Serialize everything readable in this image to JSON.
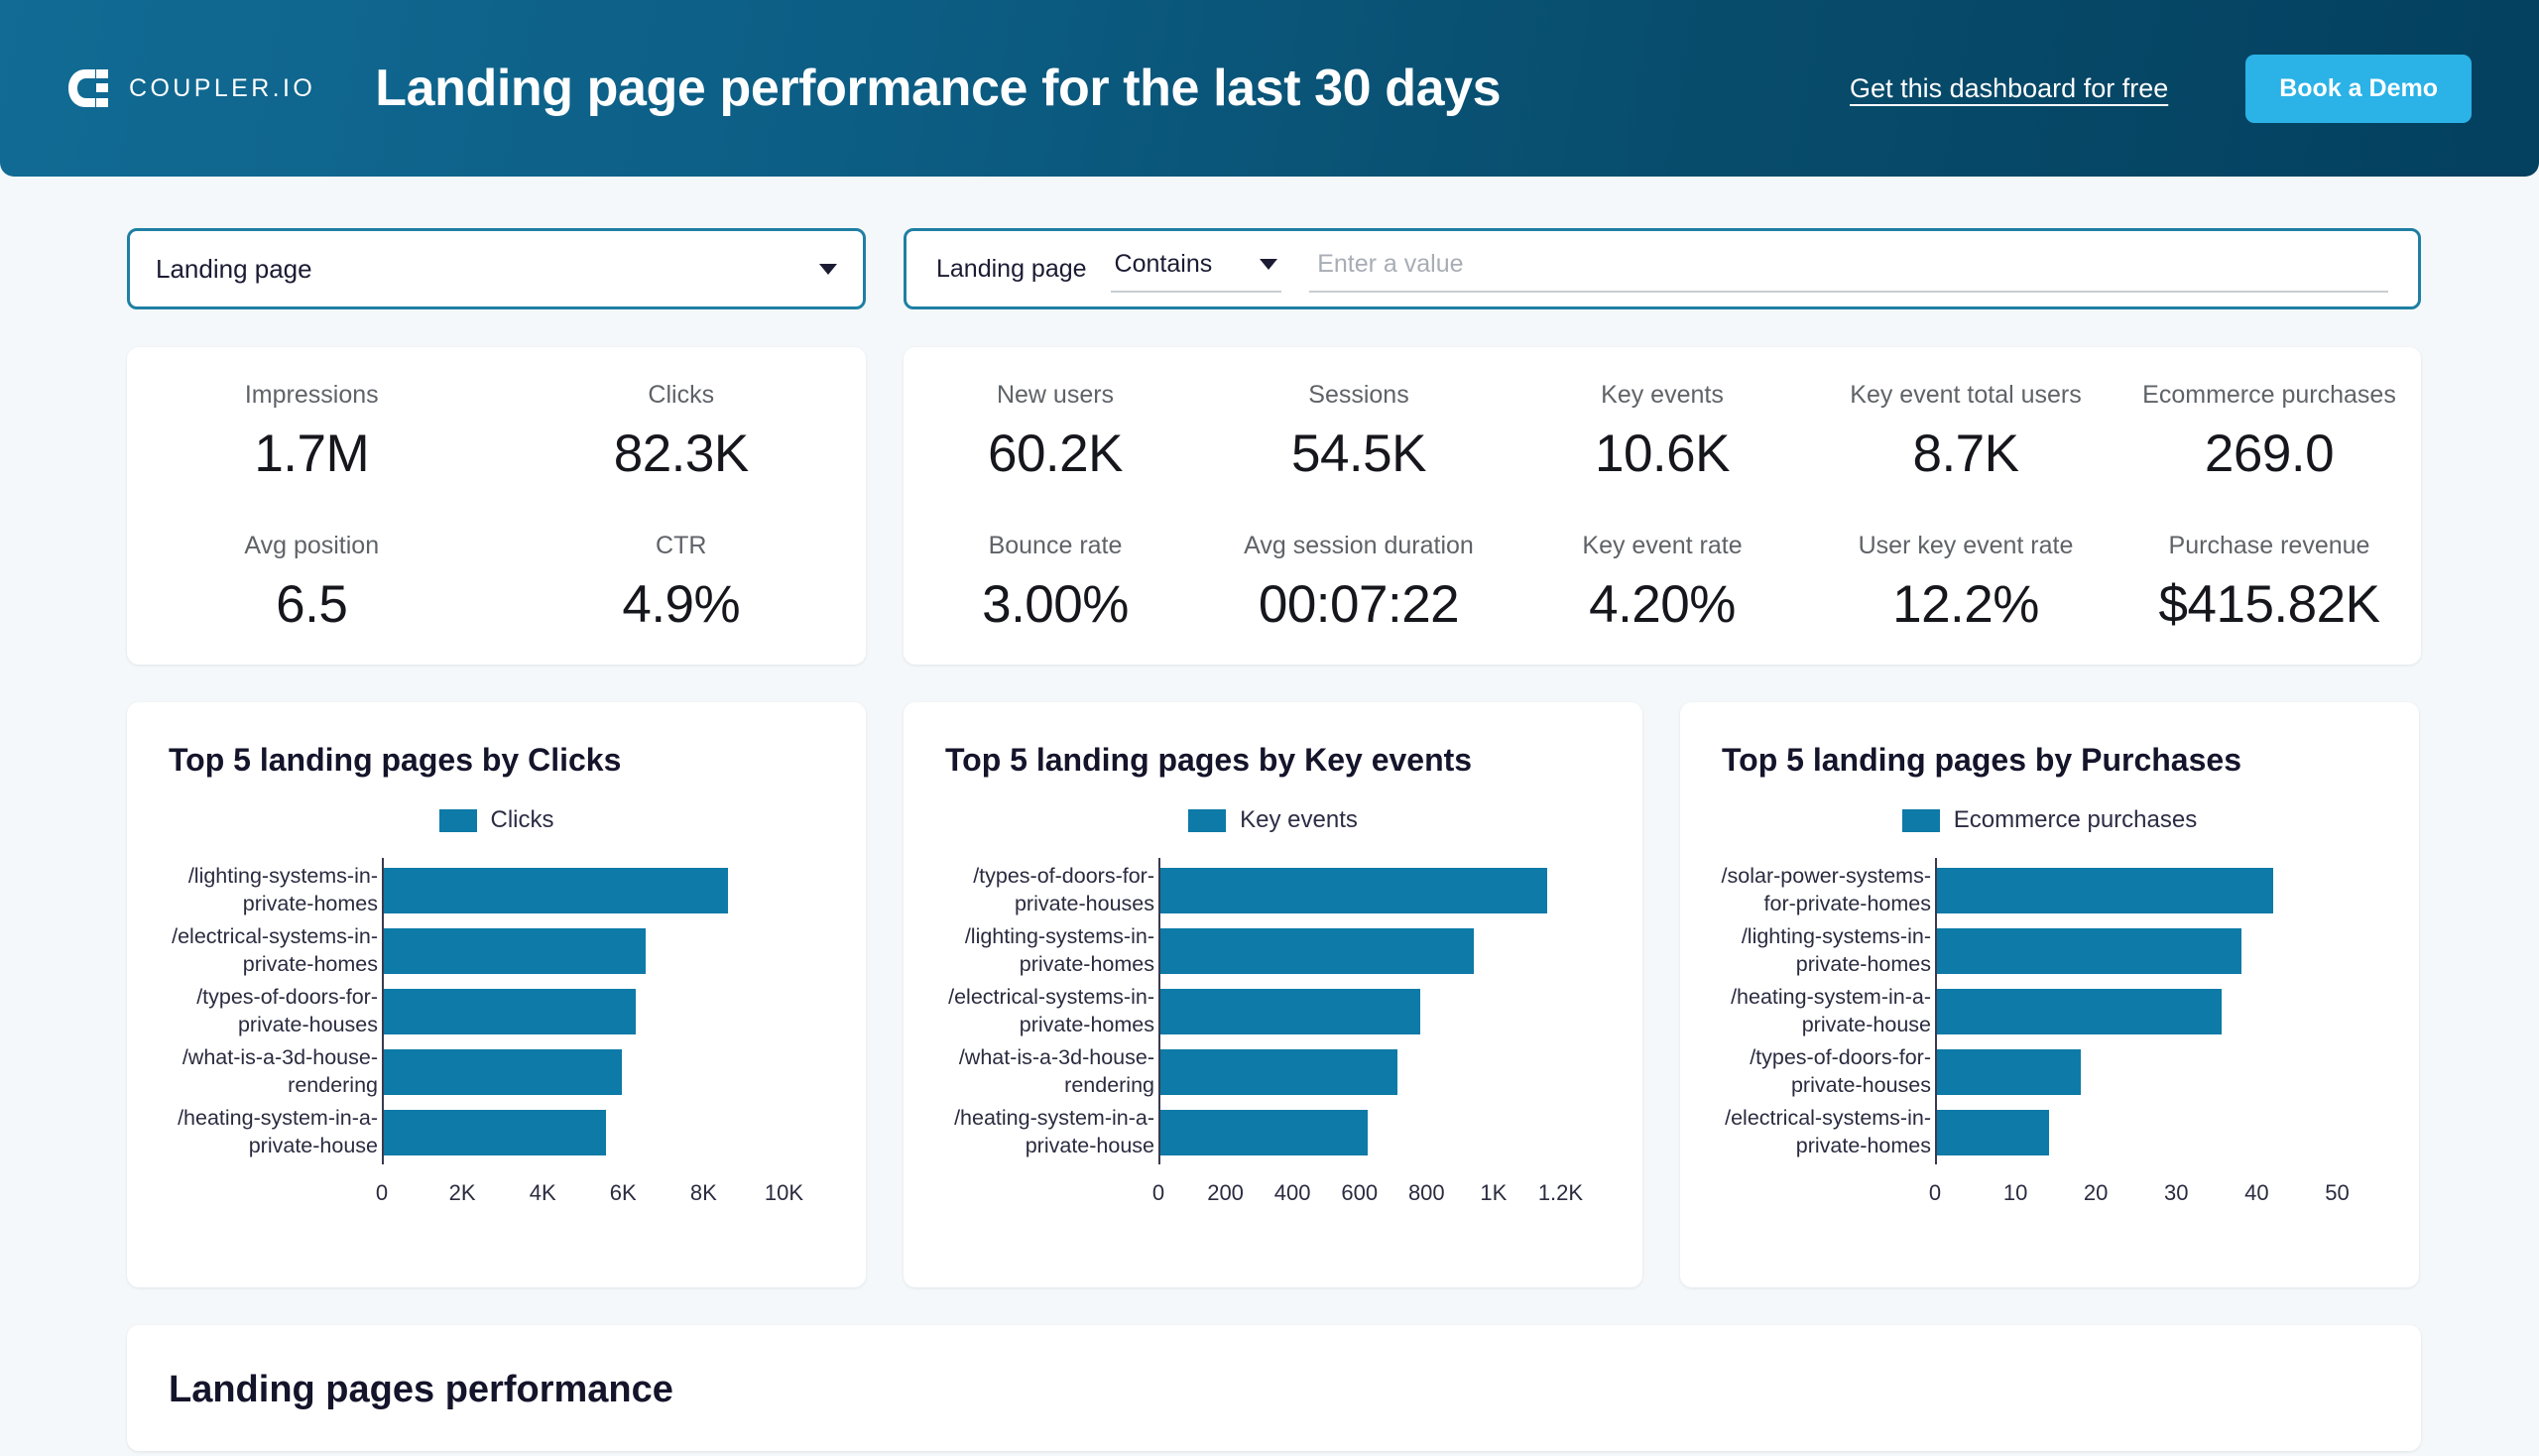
{
  "header": {
    "logo_text": "COUPLER.IO",
    "title": "Landing page performance for the last 30 days",
    "link_label": "Get this dashboard for free",
    "demo_button_label": "Book a Demo",
    "gradient_from": "#116b94",
    "gradient_to": "#04405f",
    "accent_button_color": "#2bb2e6"
  },
  "filters": {
    "dimension_select": {
      "value": "Landing page"
    },
    "advanced": {
      "field_label": "Landing page",
      "operator": "Contains",
      "value": "",
      "value_placeholder": "Enter a value"
    }
  },
  "kpis": {
    "search_card": {
      "row1": [
        {
          "label": "Impressions",
          "value": "1.7M"
        },
        {
          "label": "Clicks",
          "value": "82.3K"
        }
      ],
      "row2": [
        {
          "label": "Avg position",
          "value": "6.5"
        },
        {
          "label": "CTR",
          "value": "4.9%"
        }
      ]
    },
    "analytics_card": {
      "row1": [
        {
          "label": "New users",
          "value": "60.2K"
        },
        {
          "label": "Sessions",
          "value": "54.5K"
        },
        {
          "label": "Key events",
          "value": "10.6K"
        },
        {
          "label": "Key event total users",
          "value": "8.7K"
        },
        {
          "label": "Ecommerce purchases",
          "value": "269.0"
        }
      ],
      "row2": [
        {
          "label": "Bounce rate",
          "value": "3.00%"
        },
        {
          "label": "Avg session duration",
          "value": "00:07:22"
        },
        {
          "label": "Key event rate",
          "value": "4.20%"
        },
        {
          "label": "User key event rate",
          "value": "12.2%"
        },
        {
          "label": "Purchase revenue",
          "value": "$415.82K"
        }
      ]
    }
  },
  "bottom_panel": {
    "title": "Landing pages performance"
  },
  "chart_data": [
    {
      "type": "bar",
      "orientation": "horizontal",
      "title": "Top 5 landing pages by Clicks",
      "legend": [
        "Clicks"
      ],
      "legend_position": "top-center",
      "series_name": "Clicks",
      "bar_color": "#0d7aa7",
      "categories": [
        "/lighting-systems-in-private-homes",
        "/electrical-systems-in-private-homes",
        "/types-of-doors-for-private-houses",
        "/what-is-a-3d-house-rendering",
        "/heating-system-in-a-private-house"
      ],
      "category_lines": [
        [
          "/lighting-systems-in-",
          "private-homes"
        ],
        [
          "/electrical-systems-in-",
          "private-homes"
        ],
        [
          "/types-of-doors-for-",
          "private-houses"
        ],
        [
          "/what-is-a-3d-house-",
          "rendering"
        ],
        [
          "/heating-system-in-a-",
          "private-house"
        ]
      ],
      "values": [
        8600,
        6550,
        6300,
        5950,
        5550
      ],
      "xlabel": "",
      "ylabel": "",
      "xlim": [
        0,
        11000
      ],
      "xticks": [
        0,
        2000,
        4000,
        6000,
        8000,
        10000
      ],
      "xticklabels": [
        "0",
        "2K",
        "4K",
        "6K",
        "8K",
        "10K"
      ],
      "grid": false
    },
    {
      "type": "bar",
      "orientation": "horizontal",
      "title": "Top 5 landing pages by Key events",
      "legend": [
        "Key events"
      ],
      "legend_position": "top-center",
      "series_name": "Key events",
      "bar_color": "#0d7aa7",
      "categories": [
        "/types-of-doors-for-private-houses",
        "/lighting-systems-in-private-homes",
        "/electrical-systems-in-private-homes",
        "/what-is-a-3d-house-rendering",
        "/heating-system-in-a-private-house"
      ],
      "category_lines": [
        [
          "/types-of-doors-for-",
          "private-houses"
        ],
        [
          "/lighting-systems-in-",
          "private-homes"
        ],
        [
          "/electrical-systems-in-",
          "private-homes"
        ],
        [
          "/what-is-a-3d-house-",
          "rendering"
        ],
        [
          "/heating-system-in-a-",
          "private-house"
        ]
      ],
      "values": [
        1160,
        940,
        780,
        710,
        620
      ],
      "xlabel": "",
      "ylabel": "",
      "xlim": [
        0,
        1320
      ],
      "xticks": [
        0,
        200,
        400,
        600,
        800,
        1000,
        1200
      ],
      "xticklabels": [
        "0",
        "200",
        "400",
        "600",
        "800",
        "1K",
        "1.2K"
      ],
      "grid": false
    },
    {
      "type": "bar",
      "orientation": "horizontal",
      "title": "Top 5 landing pages by Purchases",
      "legend": [
        "Ecommerce purchases"
      ],
      "legend_position": "top-center",
      "series_name": "Ecommerce purchases",
      "bar_color": "#0d7aa7",
      "categories": [
        "/solar-power-systems-for-private-homes",
        "/lighting-systems-in-private-homes",
        "/heating-system-in-a-private-house",
        "/types-of-doors-for-private-houses",
        "/electrical-systems-in-private-homes"
      ],
      "category_lines": [
        [
          "/solar-power-systems-",
          "for-private-homes"
        ],
        [
          "/lighting-systems-in-",
          "private-homes"
        ],
        [
          "/heating-system-in-a-",
          "private-house"
        ],
        [
          "/types-of-doors-for-",
          "private-houses"
        ],
        [
          "/electrical-systems-in-",
          "private-homes"
        ]
      ],
      "values": [
        42,
        38,
        35.5,
        18,
        14
      ],
      "xlabel": "",
      "ylabel": "",
      "xlim": [
        0,
        55
      ],
      "xticks": [
        0,
        10,
        20,
        30,
        40,
        50
      ],
      "xticklabels": [
        "0",
        "10",
        "20",
        "30",
        "40",
        "50"
      ],
      "grid": false
    }
  ]
}
